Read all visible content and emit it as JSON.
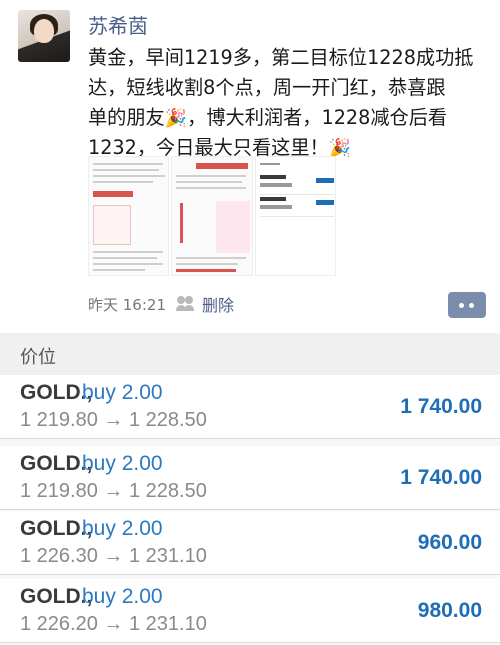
{
  "post": {
    "username": "苏希茵",
    "text_lines": [
      "黄金，早间1219多，第二目标位1228成功抵",
      "达，短线收割8个点，周一开门红，恭喜跟",
      "单的朋友",
      "，博大利润者，1228减仓后看",
      "1232，今日最大只看这里！"
    ],
    "party_icon": "🎉",
    "time": "昨天 16:21",
    "delete_label": "删除",
    "friends_icon": "friends-visibility-icon",
    "comment_icon": "comment-dots-icon"
  },
  "trades": {
    "header_label": "价位",
    "items": [
      {
        "symbol": "GOLD.,",
        "side": "buy 2.00",
        "prices": "1 219.80 → 1 228.50",
        "profit": "1 740.00"
      },
      {
        "symbol": "GOLD.,",
        "side": "buy 2.00",
        "prices": "1 219.80 → 1 228.50",
        "profit": "1 740.00"
      },
      {
        "symbol": "GOLD.,",
        "side": "buy 2.00",
        "prices": "1 226.30 → 1 231.10",
        "profit": "960.00"
      },
      {
        "symbol": "GOLD.,",
        "side": "buy 2.00",
        "prices": "1 226.20 → 1 231.10",
        "profit": "980.00"
      }
    ]
  },
  "colors": {
    "name_blue": "#4a5d8a",
    "buy_blue": "#2a79c2",
    "profit_blue": "#1f6db6"
  }
}
